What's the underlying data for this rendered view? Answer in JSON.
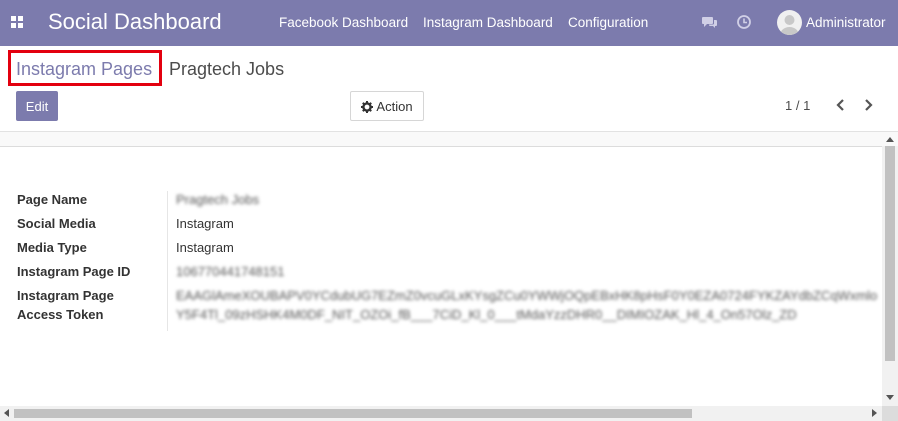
{
  "navbar": {
    "brand": "Social Dashboard",
    "links": [
      "Facebook Dashboard",
      "Instagram Dashboard",
      "Configuration"
    ],
    "user": "Administrator",
    "color": "#7c7bad"
  },
  "breadcrumb": {
    "parent": "Instagram Pages",
    "current": "Pragtech Jobs"
  },
  "toolbar": {
    "edit_label": "Edit",
    "action_label": "Action"
  },
  "pager": {
    "value": "1 / 1"
  },
  "form": {
    "fields": [
      {
        "label": "Page Name",
        "value": "Pragtech Jobs"
      },
      {
        "label": "Social Media",
        "value": "Instagram"
      },
      {
        "label": "Media Type",
        "value": "Instagram"
      },
      {
        "label": "Instagram Page ID",
        "value": "106770441748151"
      },
      {
        "label_line1": "Instagram Page",
        "label_line2": "Access Token",
        "value_line1": "EAAGlAmeXOUBAPV0YCdubUG7EZmZ0vcuGLxKYsgZCu0YWWjOQpEBxHK8pHsF0Y0EZA0724FYKZAYdbZCqWxmlo",
        "value_line2": "Y5F4Tl_09zHSHK4M0DF_NIT_OZOi_fB___7CiD_Kl_0___tMdaYzzDHR0__DIMIOZAK_Hl_4_On57Olz_ZD"
      }
    ]
  }
}
